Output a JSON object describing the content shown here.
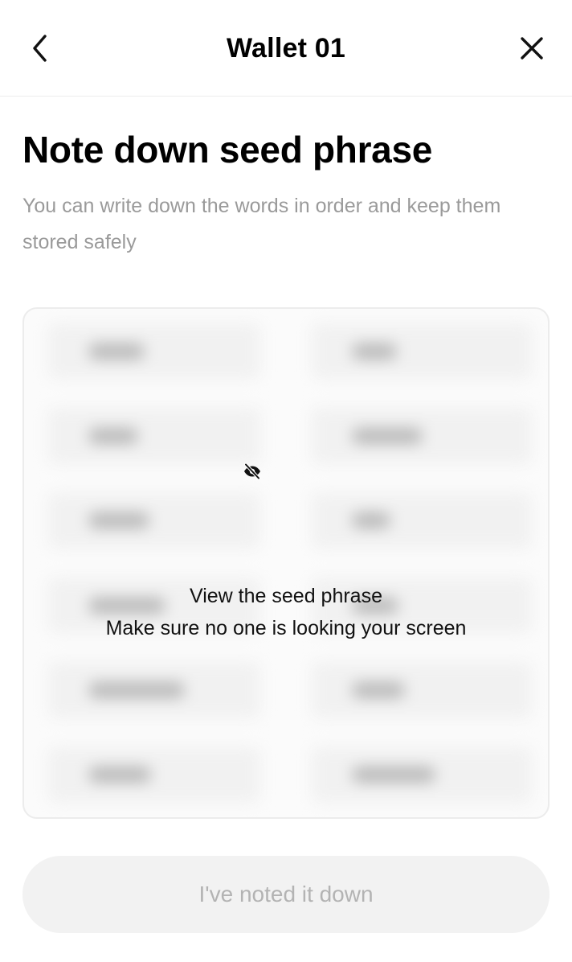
{
  "header": {
    "title": "Wallet 01",
    "back_icon": "chevron-left-icon",
    "close_icon": "close-icon"
  },
  "page": {
    "title": "Note down seed phrase",
    "subtitle": "You can write down the words in order and keep them stored safely"
  },
  "seed_card": {
    "hidden": true,
    "reveal_icon": "eye-off-icon",
    "reveal_title": "View the seed phrase",
    "reveal_warning": "Make sure no one is looking your screen",
    "rows": 6,
    "columns": 2
  },
  "footer": {
    "confirm_label": "I've noted it down",
    "confirm_enabled": false
  },
  "colors": {
    "text_primary": "#000000",
    "text_secondary": "#9a9a9a",
    "button_disabled_bg": "#f2f2f2",
    "button_disabled_text": "#b3b3b3",
    "divider": "#ececec"
  }
}
